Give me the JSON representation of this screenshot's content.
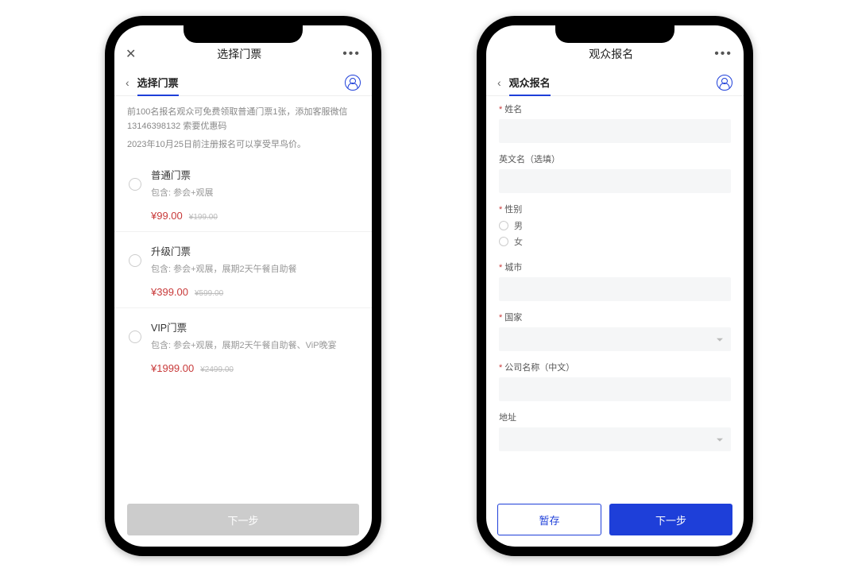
{
  "left": {
    "top_title": "选择门票",
    "sub_title": "选择门票",
    "promo_line1": "前100名报名观众可免费领取普通门票1张，添加客服微信13146398132 索要优惠码",
    "promo_line2": "2023年10月25日前注册报名可以享受早鸟价。",
    "tickets": [
      {
        "name": "普通门票",
        "desc": "包含: 参会+观展",
        "price": "¥99.00",
        "old": "¥199.00"
      },
      {
        "name": "升级门票",
        "desc": "包含: 参会+观展，展期2天午餐自助餐",
        "price": "¥399.00",
        "old": "¥599.00"
      },
      {
        "name": "VIP门票",
        "desc": "包含: 参会+观展，展期2天午餐自助餐、ViP晚宴",
        "price": "¥1999.00",
        "old": "¥2499.00"
      }
    ],
    "next": "下一步"
  },
  "right": {
    "top_title": "观众报名",
    "sub_title": "观众报名",
    "fields": {
      "name": "姓名",
      "en_name": "英文名（选填）",
      "gender": "性别",
      "male": "男",
      "female": "女",
      "city": "城市",
      "country": "国家",
      "company": "公司名称（中文）",
      "address": "地址"
    },
    "save": "暂存",
    "next": "下一步"
  }
}
